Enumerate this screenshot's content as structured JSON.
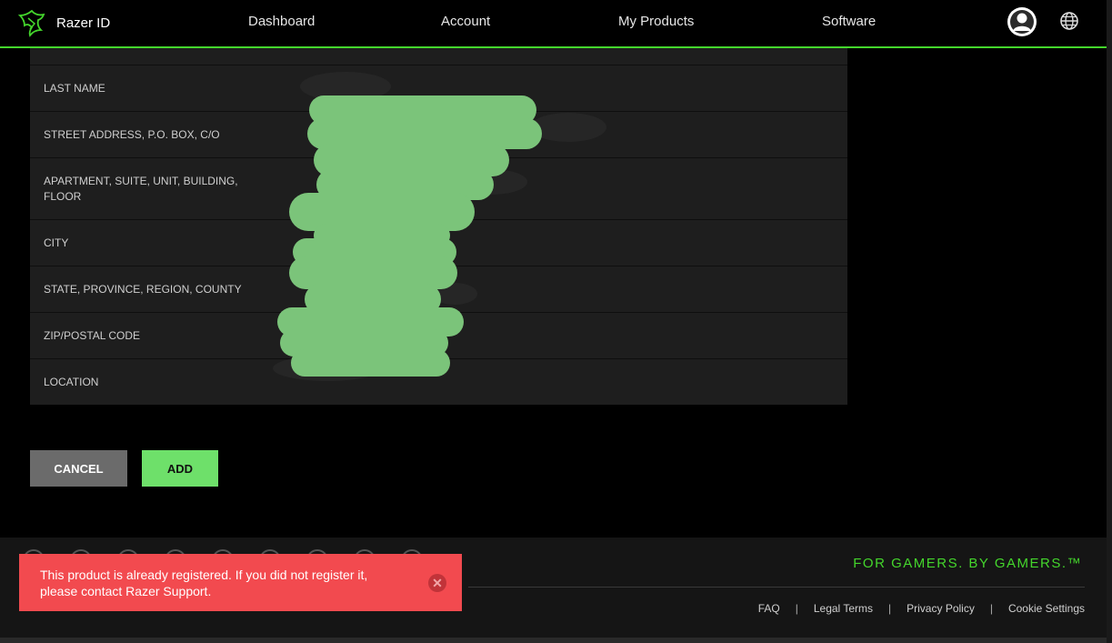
{
  "header": {
    "brand": "Razer ID",
    "nav": [
      "Dashboard",
      "Account",
      "My Products",
      "Software"
    ]
  },
  "form": {
    "rows": [
      {
        "label": "LAST NAME"
      },
      {
        "label": "STREET ADDRESS, P.O. BOX, C/O"
      },
      {
        "label": "APARTMENT, SUITE, UNIT, BUILDING, FLOOR"
      },
      {
        "label": "CITY"
      },
      {
        "label": "STATE, PROVINCE, REGION, COUNTY"
      },
      {
        "label": "ZIP/POSTAL CODE"
      },
      {
        "label": "LOCATION"
      }
    ]
  },
  "buttons": {
    "cancel": "CANCEL",
    "add": "ADD"
  },
  "footer": {
    "tagline": "FOR GAMERS. BY GAMERS.™",
    "links": [
      "FAQ",
      "Legal Terms",
      "Privacy Policy",
      "Cookie Settings"
    ],
    "separator": "|"
  },
  "toast": {
    "message": "This product is already registered. If you did not register it, please contact Razer Support.",
    "close_icon": "close-icon"
  },
  "colors": {
    "accent": "#44d62c",
    "toast": "#f24a4f",
    "add_button": "#6ee06a",
    "redaction": "#7bc47a"
  }
}
